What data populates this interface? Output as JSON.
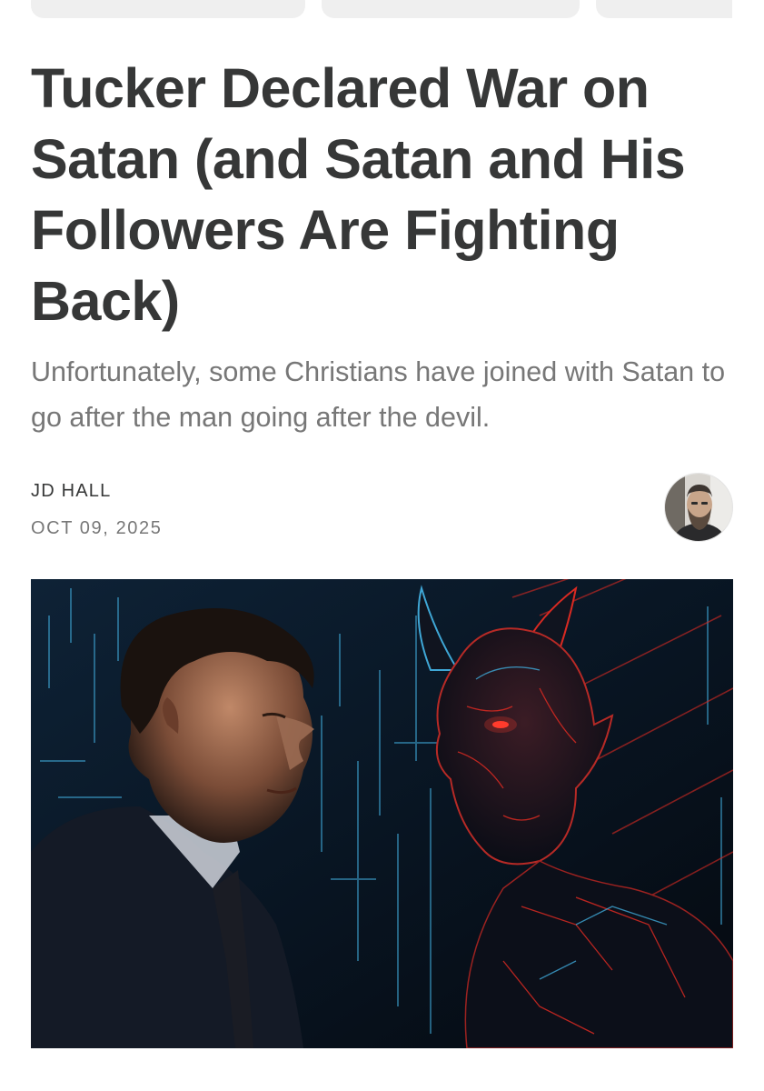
{
  "article": {
    "title": "Tucker Declared War on Satan (and Satan and His Followers Are Fighting Back)",
    "subtitle": "Unfortunately, some Christians have joined with Satan to go after the man going after the devil.",
    "author": "JD HALL",
    "date": "OCT 09, 2025"
  },
  "avatar": {
    "icon": "author-photo"
  },
  "hero": {
    "icon": "hero-illustration"
  },
  "colors": {
    "headline": "#363737",
    "subtitle": "#777777",
    "pill": "#efefef",
    "hero_dark": "#0a1420",
    "glow_red": "#d92a22",
    "glow_blue": "#3fa7d6"
  }
}
